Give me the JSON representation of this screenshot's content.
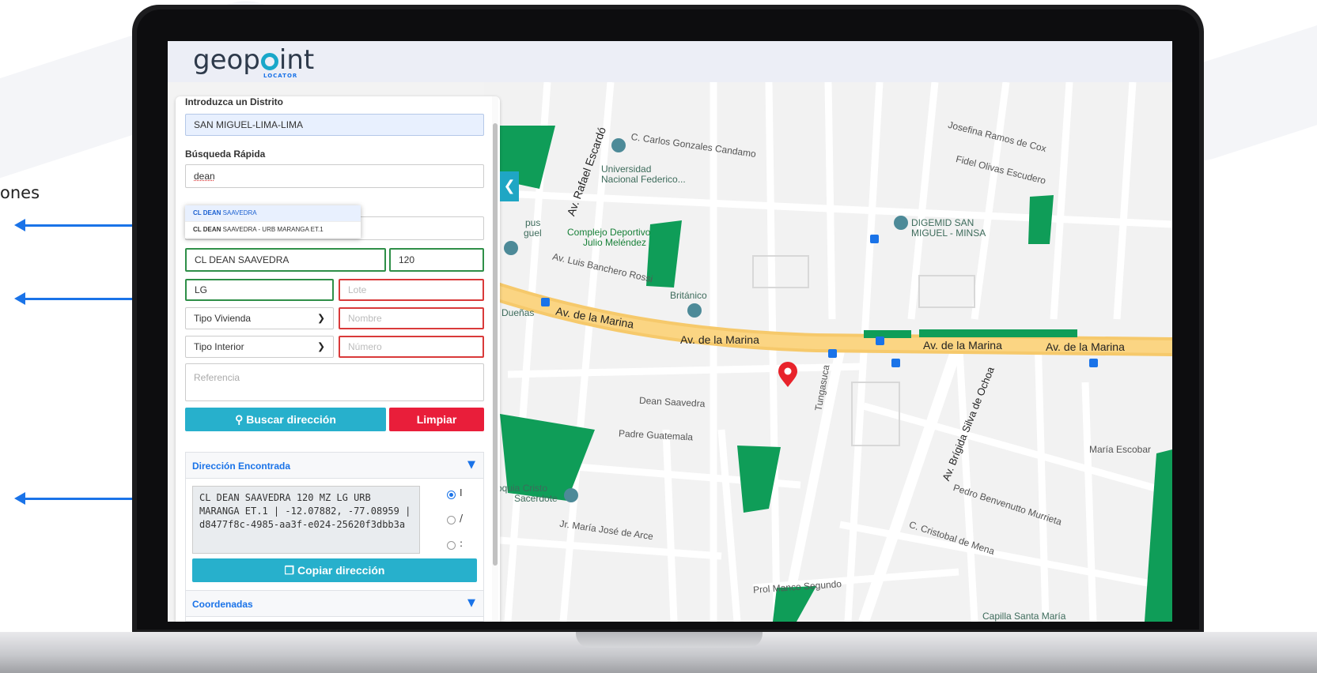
{
  "side_text": "ones",
  "app": {
    "logo_text_pre": "geop",
    "logo_text_post": "int",
    "logo_sub": "LOCATOR"
  },
  "panel": {
    "district_label": "Introduzca un Distrito",
    "district_value": "SAN MIGUEL-LIMA-LIMA",
    "quick_search_label": "Búsqueda Rápida",
    "quick_search_value": "dean",
    "suggestions": [
      {
        "bold": "CL DEAN",
        "rest": " SAAVEDRA"
      },
      {
        "bold": "CL DEAN",
        "rest": " SAAVEDRA - URB MARANGA ET.1"
      }
    ],
    "urbanization_value": "URB MARANGA ET.1",
    "street_value": "CL DEAN SAAVEDRA",
    "number_value": "120",
    "block_value": "LG",
    "lot_placeholder": "Lote",
    "housing_type": "Tipo Vivienda",
    "name_placeholder": "Nombre",
    "interior_type": "Tipo Interior",
    "number_placeholder": "Número",
    "reference_placeholder": "Referencia",
    "search_button": "Buscar dirección",
    "clear_button": "Limpiar",
    "found_title": "Dirección Encontrada",
    "found_address": "CL DEAN SAAVEDRA 120 MZ LG URB MARANGA ET.1 | -12.07882, -77.08959 | d8477f8c-4985-aa3f-e024-25620f3dbb3a",
    "radio_labels": [
      "I",
      "/",
      ":"
    ],
    "copy_button": "Copiar dirección",
    "coords_title": "Coordenadas"
  },
  "map": {
    "labels": [
      {
        "text": "C. Carlos Gonzales Candamo",
        "kind": "road"
      },
      {
        "text": "Universidad",
        "kind": "poi"
      },
      {
        "text": "Nacional Federico...",
        "kind": "poi"
      },
      {
        "text": "Complejo Deportivo",
        "kind": "poi-green"
      },
      {
        "text": "Julio Meléndez",
        "kind": "poi-green"
      },
      {
        "text": "Av. Luis Banchero Rossi",
        "kind": "road"
      },
      {
        "text": "Británico",
        "kind": "poi"
      },
      {
        "text": "Av. de la Marina",
        "kind": "road"
      },
      {
        "text": "Av. de la Marina",
        "kind": "road"
      },
      {
        "text": "Av. de la Marina",
        "kind": "road"
      },
      {
        "text": "Av. de la Marina",
        "kind": "road"
      },
      {
        "text": "Dean Saavedra",
        "kind": "road"
      },
      {
        "text": "Padre Guatemala",
        "kind": "road"
      },
      {
        "text": "Tungasuca",
        "kind": "road"
      },
      {
        "text": "DIGEMID SAN",
        "kind": "poi"
      },
      {
        "text": "MIGUEL - MINSA",
        "kind": "poi"
      },
      {
        "text": "Josefina Ramos de Cox",
        "kind": "road"
      },
      {
        "text": "Fidel Olivas Escudero",
        "kind": "road"
      },
      {
        "text": "Av. Rafael Escardó",
        "kind": "road"
      },
      {
        "text": "Av. Brígida Silva de Ochoa",
        "kind": "road"
      },
      {
        "text": "María Escobar",
        "kind": "road"
      },
      {
        "text": "Pedro Benvenutto Murrieta",
        "kind": "road"
      },
      {
        "text": "C. Cristobal de Mena",
        "kind": "road"
      },
      {
        "text": "Jr. María José de Arce",
        "kind": "road"
      },
      {
        "text": "Prol Manco Segundo",
        "kind": "road"
      },
      {
        "text": "roquia Cristo",
        "kind": "poi"
      },
      {
        "text": "Sacerdote",
        "kind": "poi"
      },
      {
        "text": "Capilla Santa María",
        "kind": "poi"
      },
      {
        "text": "Dueñas",
        "kind": "poi"
      },
      {
        "text": "pus",
        "kind": "poi"
      },
      {
        "text": "guel",
        "kind": "poi"
      }
    ]
  },
  "colors": {
    "accent": "#27b0cc",
    "danger": "#e91e3a",
    "valid": "#2f8f48",
    "invalid": "#d93a3a",
    "park": "#0f9d58",
    "avenue": "#fbd583"
  }
}
